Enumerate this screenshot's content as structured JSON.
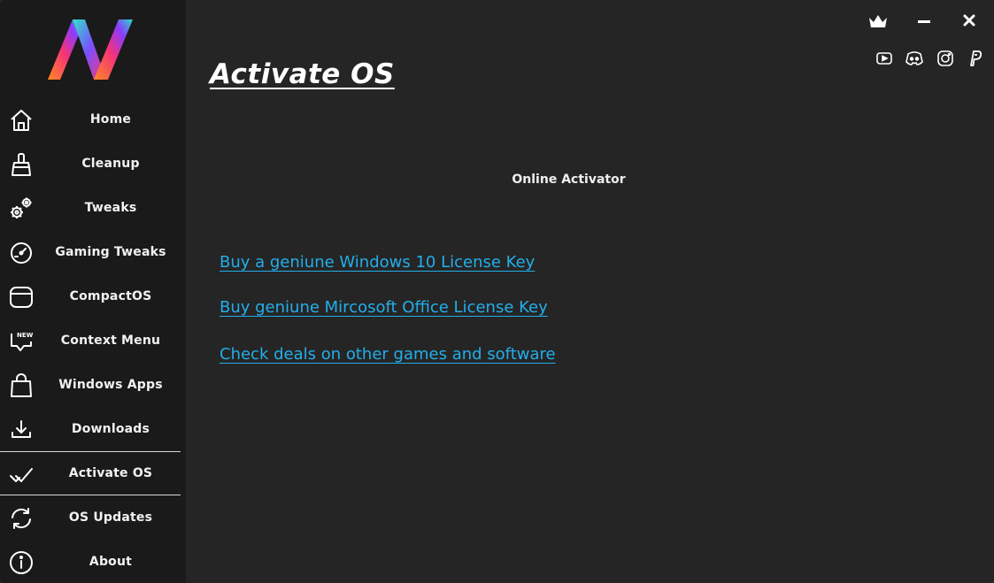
{
  "sidebar": {
    "items": [
      {
        "label": "Home",
        "icon": "home-icon"
      },
      {
        "label": "Cleanup",
        "icon": "broom-icon"
      },
      {
        "label": "Tweaks",
        "icon": "gears-icon"
      },
      {
        "label": "Gaming Tweaks",
        "icon": "speedometer-icon"
      },
      {
        "label": "CompactOS",
        "icon": "compact-window-icon"
      },
      {
        "label": "Context Menu",
        "icon": "new-badge-chat-icon"
      },
      {
        "label": "Windows Apps",
        "icon": "shopping-bag-icon"
      },
      {
        "label": "Downloads",
        "icon": "download-icon"
      },
      {
        "label": "Activate OS",
        "icon": "checkmark-icon"
      },
      {
        "label": "OS Updates",
        "icon": "refresh-icon"
      },
      {
        "label": "About",
        "icon": "info-icon"
      }
    ],
    "active": "Activate OS",
    "new_badge": "NEW!"
  },
  "main": {
    "title": "Activate OS",
    "section_label": "Online Activator",
    "links": [
      "Buy a geniune Windows 10 License Key",
      "Buy geniune Mircosoft Office License Key",
      "Check deals on other games and software"
    ]
  },
  "colors": {
    "background": "#252525",
    "sidebar": "#1a1a1a",
    "link": "#23aeea",
    "text": "#ffffff"
  }
}
